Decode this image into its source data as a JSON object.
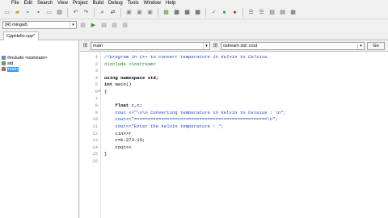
{
  "menu": [
    "File",
    "Edit",
    "Search",
    "View",
    "Project",
    "Build",
    "Debug",
    "Tools",
    "Window",
    "Help"
  ],
  "compiler_select": "(R) mingw5",
  "file_tab": "CppHello.cpp*",
  "class_browser": [
    {
      "icon": "include-icon",
      "label": "#include <iostream>",
      "selected": false
    },
    {
      "icon": "namespace-icon",
      "label": "std",
      "selected": false
    },
    {
      "icon": "function-icon",
      "label": "main",
      "selected": true
    }
  ],
  "editor_bar": {
    "scope_select": "main",
    "symbol_select": "ostream std::cout",
    "go_label": "Go"
  },
  "code_lines": [
    {
      "n": "1",
      "fold": "",
      "tokens": [
        {
          "t": "//program in C++ to convert temperature in Kelvin to Celsius.",
          "c": "comment"
        }
      ]
    },
    {
      "n": "2",
      "fold": "",
      "tokens": [
        {
          "t": "#include <iostream>",
          "c": "pre"
        }
      ]
    },
    {
      "n": "3",
      "fold": "",
      "tokens": []
    },
    {
      "n": "4",
      "fold": "",
      "tokens": [
        {
          "t": "using namespace std;",
          "c": "kw"
        }
      ]
    },
    {
      "n": "5",
      "fold": "",
      "tokens": [
        {
          "t": "int ",
          "c": "kw"
        },
        {
          "t": "main()",
          "c": "plain"
        }
      ]
    },
    {
      "n": "6",
      "fold": "⊟",
      "tokens": [
        {
          "t": "{",
          "c": "plain"
        }
      ]
    },
    {
      "n": "7",
      "fold": "",
      "tokens": []
    },
    {
      "n": "8",
      "fold": "",
      "tokens": [
        {
          "t": "    float ",
          "c": "kw"
        },
        {
          "t": "c,c;",
          "c": "plain"
        }
      ]
    },
    {
      "n": "9",
      "fold": "",
      "tokens": [
        {
          "t": "    cout <<\"\\n\\n Converting temperature in Kelvin to Celsius : \\n\";",
          "c": "str"
        }
      ]
    },
    {
      "n": "10",
      "fold": "",
      "tokens": [
        {
          "t": "    cout<<\"=================================================\\n\";",
          "c": "str"
        }
      ]
    },
    {
      "n": "11",
      "fold": "",
      "tokens": [
        {
          "t": "    cout<<\"Enter the Kelvin temperature : \";",
          "c": "str"
        }
      ]
    },
    {
      "n": "12",
      "fold": "",
      "tokens": [
        {
          "t": "    cin>>r",
          "c": "plain"
        }
      ]
    },
    {
      "n": "13",
      "fold": "",
      "tokens": [
        {
          "t": "    c=k-273.15;",
          "c": "plain"
        }
      ]
    },
    {
      "n": "14",
      "fold": "",
      "tokens": [
        {
          "t": "    cout<<",
          "c": "plain"
        }
      ]
    },
    {
      "n": "15",
      "fold": "",
      "tokens": [
        {
          "t": "}",
          "c": "plain"
        }
      ]
    },
    {
      "n": "16",
      "fold": "",
      "tokens": []
    }
  ]
}
